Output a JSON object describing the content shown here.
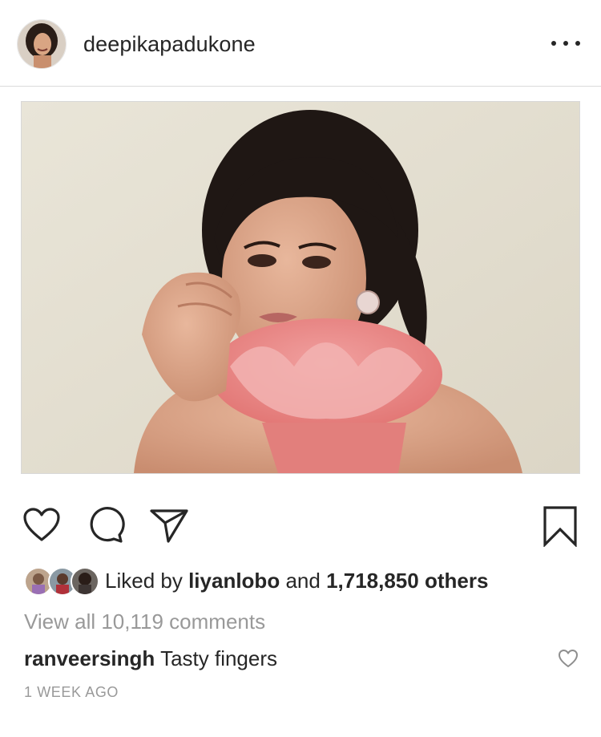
{
  "post": {
    "username": "deepikapadukone",
    "more_menu": "more-options",
    "photo_subject": "portrait-photo"
  },
  "actions": {
    "like_icon": "heart-outline-icon",
    "comment_icon": "speech-bubble-icon",
    "share_icon": "paper-plane-icon",
    "save_icon": "bookmark-icon"
  },
  "likes": {
    "prefix": "Liked by",
    "first_liker": "liyanlobo",
    "connector": "and",
    "others": "1,718,850 others"
  },
  "comments": {
    "view_all": "View all 10,119 comments",
    "items": [
      {
        "user": "ranveersingh",
        "text": "Tasty fingers"
      }
    ]
  },
  "timestamp": "1 WEEK AGO",
  "colors": {
    "text": "#262626",
    "muted": "#999999",
    "divider": "#dbdbdb"
  }
}
